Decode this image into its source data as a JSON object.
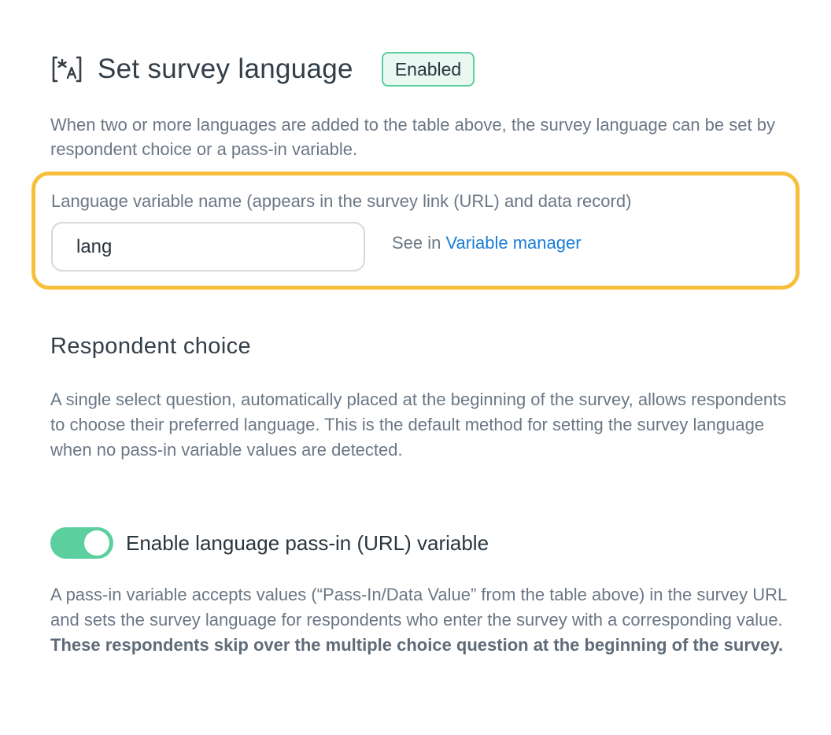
{
  "header": {
    "icon": "translate-icon",
    "title": "Set survey language",
    "badge": "Enabled"
  },
  "intro": "When two or more languages are added to the table above, the survey language can be set by respondent choice or a pass-in variable.",
  "variable": {
    "label": "Language variable name (appears in the survey link (URL) and data record)",
    "value": "lang",
    "see_in_prefix": "See in ",
    "link_label": "Variable manager"
  },
  "respondent_choice": {
    "title": "Respondent choice",
    "description": "A single select question, automatically placed at the beginning of the survey, allows respondents to choose their preferred language. This is the default method for setting the survey language when no pass-in variable values are detected."
  },
  "passin": {
    "toggle_on": true,
    "toggle_label": "Enable language pass-in (URL) variable",
    "description_plain": "A pass-in variable accepts values (“Pass-In/Data Value” from the table above) in the survey URL and sets the survey language for respondents who enter the survey with a corresponding value. ",
    "description_bold": "These respondents skip over the multiple choice question at the beginning of the survey."
  },
  "colors": {
    "highlight_border": "#f8bf3c",
    "badge_border": "#5ccf9e",
    "badge_bg": "#e9f8f1",
    "toggle_on": "#5ccf9e",
    "link": "#1b7dd6"
  }
}
